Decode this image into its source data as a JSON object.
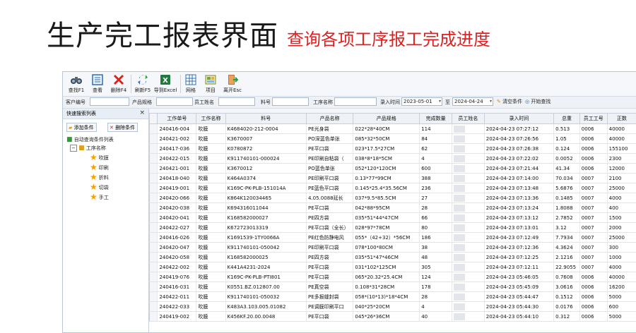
{
  "header": {
    "title": "生产完工报表界面",
    "subtitle": "查询各项工序报工完成进度"
  },
  "toolbar": [
    {
      "label": "查找F1",
      "icon": "binoculars-icon"
    },
    {
      "label": "查看",
      "icon": "view-icon"
    },
    {
      "label": "删除F4",
      "icon": "delete-icon"
    },
    {
      "label": "刷新F5",
      "icon": "refresh-icon"
    },
    {
      "label": "导到Excel",
      "icon": "excel-icon"
    },
    {
      "label": "网格",
      "icon": "grid-icon"
    },
    {
      "label": "项目",
      "icon": "project-icon"
    },
    {
      "label": "离开Esc",
      "icon": "exit-icon"
    }
  ],
  "filter": {
    "customer_code": "客户编号",
    "product_spec": "产品规格",
    "employee_name": "员工姓名",
    "material_no": "料号",
    "process_name": "工序名称",
    "entry_time": "录入时间",
    "date_from": "2023-05-01",
    "to": "至",
    "date_to": "2024-04-24",
    "clear_button": "清空条件",
    "start_button": "开始查找"
  },
  "left_panel": {
    "title": "快速搜索列表",
    "add_button": "添加条件",
    "delete_button": "删除条件",
    "tree_root": "自动查询条件列表",
    "tree_group": "工序名称",
    "tree_items": [
      "吹膜",
      "印刷",
      "折料",
      "切袋",
      "手工"
    ]
  },
  "grid": {
    "columns": [
      "工作单号",
      "工作名称",
      "料号",
      "产品名称",
      "产品规格",
      "完成数量",
      "员工姓名",
      "录入时间",
      "总重",
      "员工工号",
      "正数"
    ],
    "rows": [
      [
        "240416-004",
        "吹膜",
        "K4684020-212-0004",
        "PE光身袋",
        "022*28*40CM",
        "114",
        "",
        "2024-04-23 07:27:12",
        "0.513",
        "0006",
        "40000"
      ],
      [
        "240421-002",
        "吹膜",
        "K3670007",
        "PO深蓝色单张",
        "085*32*50CM",
        "84",
        "",
        "2024-04-23 07:26:56",
        "1.05",
        "0006",
        "40000"
      ],
      [
        "240417-036",
        "吹膜",
        "K0780872",
        "PE平口袋",
        "023*17.5*27CM",
        "62",
        "",
        "2024-04-23 07:26:38",
        "0.124",
        "0006",
        "155100"
      ],
      [
        "240422-015",
        "吹膜",
        "K911740101-000024",
        "PE印刷自粘袋（",
        "038*8*18*5CM",
        "4",
        "",
        "2024-04-23 07:22:02",
        "0.0052",
        "0006",
        "2300"
      ],
      [
        "240421-001",
        "吹膜",
        "K3670012",
        "PO蓝色单张",
        "052*120*120CM",
        "600",
        "",
        "2024-04-23 07:21:44",
        "41.34",
        "0006",
        "12000"
      ],
      [
        "240418-040",
        "吹膜",
        "K464A0374",
        "PE印刷平口袋",
        "0.13*77*99CM",
        "388",
        "",
        "2024-04-23 07:14:00",
        "70.034",
        "0007",
        "2100"
      ],
      [
        "240419-001",
        "吹膜",
        "K169C-PK-PLB-151014A",
        "PE蓝色平口袋",
        "0.145*25.4*35.56CM",
        "236",
        "",
        "2024-04-23 07:13:48",
        "5.6876",
        "0007",
        "25000"
      ],
      [
        "240420-066",
        "吹膜",
        "K864K120034465",
        "4.05.0088延长",
        "037*9.5*85.5CM",
        "27",
        "",
        "2024-04-23 07:13:36",
        "0.1485",
        "0007",
        "4000"
      ],
      [
        "240420-038",
        "吹膜",
        "K694316011044",
        "PE平口袋",
        "042*88*95CM",
        "28",
        "",
        "2024-04-23 07:13:24",
        "1.8088",
        "0007",
        "400"
      ],
      [
        "240420-041",
        "吹膜",
        "K168582000027",
        "PE四方袋",
        "035*51*44*47CM",
        "66",
        "",
        "2024-04-23 07:13:12",
        "2.7852",
        "0007",
        "1500"
      ],
      [
        "240422-027",
        "吹膜",
        "K672723013319",
        "PE平口袋（全长）",
        "028*97*78CM",
        "80",
        "",
        "2024-04-23 07:13:01",
        "3.12",
        "0007",
        "2000"
      ],
      [
        "240416-026",
        "吹膜",
        "K1691539-1TY0066A",
        "PE红色防静电风",
        "055*（42+32）*56CM",
        "186",
        "",
        "2024-04-23 07:12:49",
        "7.7934",
        "0007",
        "25000"
      ],
      [
        "240420-047",
        "吹膜",
        "K911740101-050042",
        "PE印刷平口袋",
        "078*100*80CM",
        "38",
        "",
        "2024-04-23 07:12:36",
        "4.3624",
        "0007",
        "300"
      ],
      [
        "240420-058",
        "吹膜",
        "K168582000025",
        "PE四方袋",
        "035*51*47*46CM",
        "48",
        "",
        "2024-04-23 07:12:25",
        "2.1216",
        "0007",
        "1000"
      ],
      [
        "240422-002",
        "吹膜",
        "K441A4231-2024",
        "PE平口袋",
        "031*102*125CM",
        "305",
        "",
        "2024-04-23 07:12:11",
        "22.9055",
        "0007",
        "4000"
      ],
      [
        "240419-076",
        "吹膜",
        "K169C-PK-PLB-PTI801",
        "PE平口袋",
        "065*20.32*25.4CM",
        "124",
        "",
        "2024-04-23 05:46:05",
        "0.7608",
        "0006",
        "40000"
      ],
      [
        "240416-031",
        "吹膜",
        "K0551.BZ.012807.00",
        "PE真空袋",
        "0.108*31*28CM",
        "178",
        "",
        "2024-04-23 05:45:09",
        "3.0616",
        "0006",
        "16200"
      ],
      [
        "240422-011",
        "吹膜",
        "K911740101-050032",
        "PE多报缝封袋",
        "058*(10*13)*18*4CM",
        "28",
        "",
        "2024-04-23 05:44:47",
        "0.1512",
        "0006",
        "5000"
      ],
      [
        "240422-033",
        "吹膜",
        "K483A3.103.005.01082",
        "PE调膜印刷平口",
        "040*25*20CM",
        "4",
        "",
        "2024-04-23 05:44:30",
        "0.0176",
        "0006",
        "600"
      ],
      [
        "240419-002",
        "吹膜",
        "K456KF.20.00.0048",
        "PE平口袋",
        "045*26*36CM",
        "40",
        "",
        "2024-04-23 05:44:10",
        "0.312",
        "0006",
        "5000"
      ]
    ]
  }
}
